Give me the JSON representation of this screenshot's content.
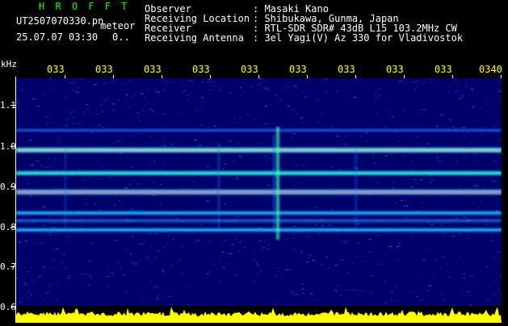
{
  "header": {
    "app_name": "H R O F F T",
    "filename": "UT2507070330.pn",
    "meteor_label": "meteor",
    "datetime": "25.07.07 03:30",
    "count": "0.."
  },
  "info": {
    "observer_label": "Observer",
    "observer_value": ": Masaki Kano",
    "location_label": "Receiving Location",
    "location_value": ": Shibukawa, Gunma, Japan",
    "receiver_label": "Receiver",
    "receiver_value": ": RTL-SDR SDR# 43dB L15 103.2MHz CW",
    "antenna_label": "Receiving Antenna",
    "antenna_value": ": 3el Yagi(V) Az 330 for Vladivostok"
  },
  "axes": {
    "y_unit": "kHz",
    "y_ticks": [
      "1.1",
      "1.0",
      "0.9",
      "0.8",
      "0.7",
      "0.6"
    ],
    "x_ticks": [
      "033",
      "033",
      "033",
      "033",
      "033",
      "033",
      "033",
      "033",
      "033",
      "0340"
    ]
  },
  "colors": {
    "background": "#000000",
    "plot_bg": "#00006a",
    "header_green": "#00ff00",
    "tick_yellow": "#ffff00",
    "signal_yellow": "#ffff00"
  }
}
